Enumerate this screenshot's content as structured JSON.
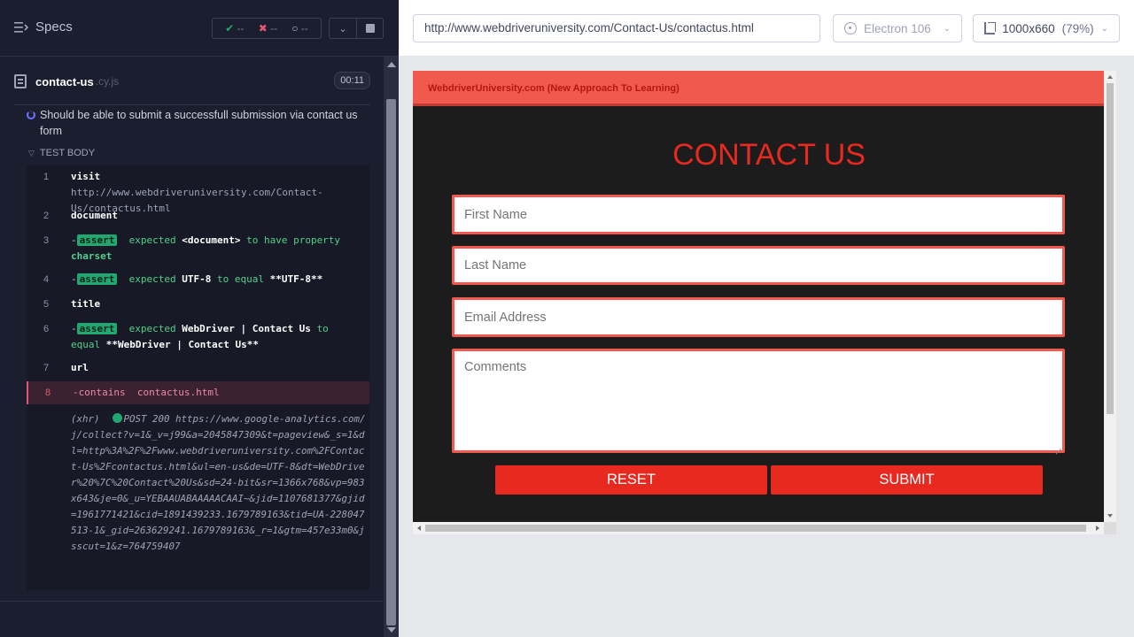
{
  "runner": {
    "specs_label": "Specs",
    "stats": {
      "passed": "--",
      "failed": "--",
      "pending": "--"
    },
    "spec": {
      "name": "contact-us",
      "ext": ".cy.js",
      "duration": "00:11"
    },
    "test_title": "Should be able to submit a successfull submission via contact us form",
    "test_body_label": "TEST BODY",
    "commands": [
      {
        "num": "1",
        "name": "visit",
        "message": "http://www.webdriveruniversity.com/Contact-Us/contactus.html"
      },
      {
        "num": "2",
        "name": "document"
      },
      {
        "num": "3",
        "badge": "assert",
        "p1": "expected",
        "p2": "<document>",
        "p3": "to have property",
        "p4": "charset"
      },
      {
        "num": "4",
        "badge": "assert",
        "p1": "expected",
        "p2": "UTF-8",
        "p3": "to equal",
        "p4": "**UTF-8**"
      },
      {
        "num": "5",
        "name": "title"
      },
      {
        "num": "6",
        "badge": "assert",
        "p1": "expected",
        "p2": "WebDriver | Contact Us",
        "p3": "to equal",
        "p4": "**WebDriver | Contact Us**"
      },
      {
        "num": "7",
        "name": "url"
      },
      {
        "num": "8",
        "name": "-contains",
        "message": "contactus.html"
      }
    ],
    "xhr": {
      "tag": "(xhr)",
      "request": "POST 200 https://www.google-analytics.com/j/collect?v=1&_v=j99&a=2045847309&t=pageview&_s=1&dl=http%3A%2F%2Fwww.webdriveruniversity.com%2FContact-Us%2Fcontactus.html&ul=en-us&de=UTF-8&dt=WebDriver%20%7C%20Contact%20Us&sd=24-bit&sr=1366x768&vp=983x643&je=0&_u=YEBAAUABAAAAACAAI~&jid=1107681377&gjid=1961771421&cid=1891439233.1679789163&tid=UA-228047513-1&_gid=263629241.1679789163&_r=1&gtm=457e33m0&jsscut=1&z=764759407"
    }
  },
  "aut": {
    "url": "http://www.webdriveruniversity.com/Contact-Us/contactus.html",
    "browser": "Electron 106",
    "viewport": "1000x660",
    "zoom": "(79%)"
  },
  "site": {
    "brand": "WebdriverUniversity.com (New Approach To Learning)",
    "title": "CONTACT US",
    "first_name_placeholder": "First Name",
    "last_name_placeholder": "Last Name",
    "email_placeholder": "Email Address",
    "comments_placeholder": "Comments",
    "reset_label": "RESET",
    "submit_label": "SUBMIT"
  },
  "colors": {
    "runner_bg": "#1b1e2e",
    "pass": "#1fa971",
    "fail": "#e45770",
    "site_accent": "#e8291f",
    "site_nav": "#f0594d"
  }
}
